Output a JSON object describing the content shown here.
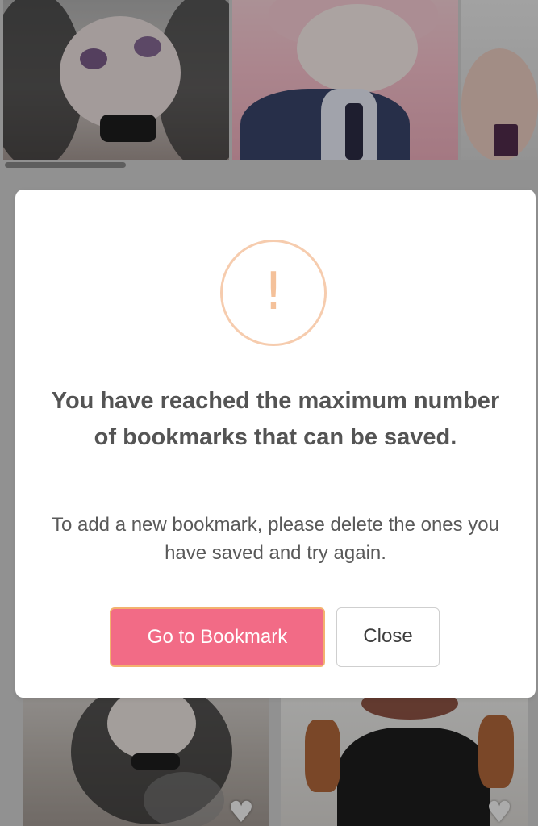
{
  "dialog": {
    "title": "You have reached the maximum number of bookmarks that can be saved.",
    "message": "To add a new bookmark, please delete the ones you have saved and try again.",
    "warning_icon": "!",
    "primary_button": "Go to Bookmark",
    "secondary_button": "Close"
  },
  "gallery": {
    "favorite_icon": "heart-icon"
  },
  "colors": {
    "primary_button": "#f26b86",
    "warning_circle": "#f6ccae",
    "title_text": "#545454"
  }
}
